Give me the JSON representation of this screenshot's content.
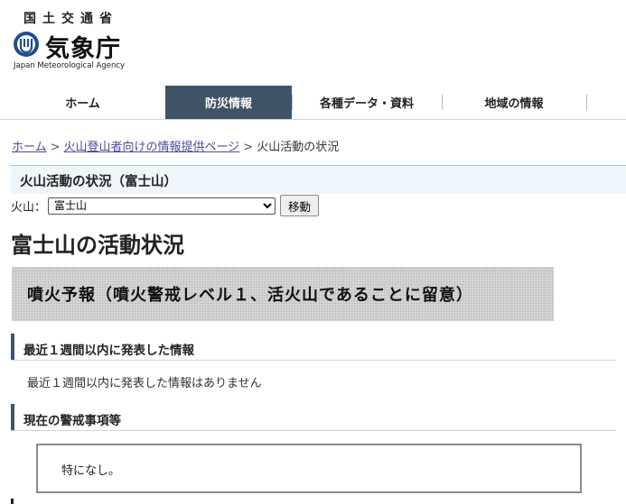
{
  "header": {
    "ministry": "国土交通省",
    "agency_name": "気象庁",
    "agency_en": "Japan Meteorological Agency"
  },
  "nav": {
    "items": [
      {
        "label": "ホーム"
      },
      {
        "label": "防災情報",
        "active": true
      },
      {
        "label": "各種データ・資料"
      },
      {
        "label": "地域の情報"
      }
    ]
  },
  "breadcrumb": {
    "home": "ホーム",
    "separator": ">",
    "volcano_page": "火山登山者向けの情報提供ページ",
    "current": "火山活動の状況"
  },
  "section_title": "火山活動の状況（富士山）",
  "selector": {
    "label": "火山：",
    "selected": "富士山",
    "button": "移動"
  },
  "heading": "富士山の活動状況",
  "forecast": "噴火予報（噴火警戒レベル１、活火山であることに留意）",
  "recent_info": {
    "title": "最近１週間以内に発表した情報",
    "text": "最近１週間以内に発表した情報はありません"
  },
  "warnings": {
    "title": "現在の警戒事項等",
    "text": "特になし。"
  },
  "colors": {
    "nav_active": "#3e5366",
    "link": "#4a4a9c",
    "title_bg": "#eef6fb",
    "accent_bar": "#3e5366"
  }
}
